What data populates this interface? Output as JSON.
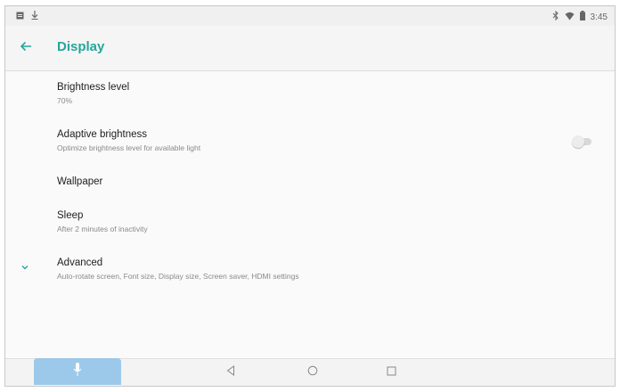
{
  "status_bar": {
    "time": "3:45",
    "left_icons": [
      "notification-icon",
      "download-icon"
    ],
    "right_icons": [
      "bluetooth-icon",
      "wifi-icon",
      "battery-icon"
    ]
  },
  "app_bar": {
    "title": "Display",
    "back_icon": "arrow-back-icon",
    "accent_color": "#26a69a"
  },
  "settings": [
    {
      "title": "Brightness level",
      "subtitle": "70%"
    },
    {
      "title": "Adaptive brightness",
      "subtitle": "Optimize brightness level for available light",
      "toggle": "off"
    },
    {
      "title": "Wallpaper",
      "subtitle": ""
    },
    {
      "title": "Sleep",
      "subtitle": "After 2 minutes of inactivity"
    },
    {
      "title": "Advanced",
      "subtitle": "Auto-rotate screen, Font size, Display size, Screen saver, HDMI settings",
      "icon": "chevron-down-icon"
    }
  ],
  "nav_bar": {
    "icons": [
      "mic-icon",
      "back-triangle-icon",
      "home-circle-icon",
      "recents-square-icon"
    ],
    "mic_button_color": "#9cc9ea"
  }
}
